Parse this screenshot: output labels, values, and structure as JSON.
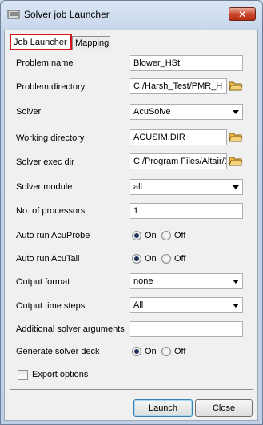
{
  "window": {
    "title": "Solver job Launcher",
    "close_glyph": "✕"
  },
  "tabs": [
    {
      "label": "Job Launcher",
      "active": true
    },
    {
      "label": "Mapping",
      "active": false
    }
  ],
  "fields": {
    "problem_name": {
      "label": "Problem name",
      "value": "Blower_HSt"
    },
    "problem_directory": {
      "label": "Problem directory",
      "value": "C:/Harsh_Test/PMR_H"
    },
    "solver": {
      "label": "Solver",
      "value": "AcuSolve"
    },
    "working_directory": {
      "label": "Working directory",
      "value": "ACUSIM.DIR"
    },
    "solver_exec_dir": {
      "label": "Solver exec dir",
      "value": "C:/Program Files/Altair/1"
    },
    "solver_module": {
      "label": "Solver module",
      "value": "all"
    },
    "num_processors": {
      "label": "No. of processors",
      "value": "1"
    },
    "auto_run_acuprobe": {
      "label": "Auto run AcuProbe",
      "on_label": "On",
      "off_label": "Off",
      "selected": "On"
    },
    "auto_run_acutail": {
      "label": "Auto run AcuTail",
      "on_label": "On",
      "off_label": "Off",
      "selected": "On"
    },
    "output_format": {
      "label": "Output format",
      "value": "none"
    },
    "output_time_steps": {
      "label": "Output time steps",
      "value": "All"
    },
    "additional_args": {
      "label": "Additional solver arguments",
      "value": ""
    },
    "generate_deck": {
      "label": "Generate solver deck",
      "on_label": "On",
      "off_label": "Off",
      "selected": "On"
    },
    "export_options": {
      "label": "Export options",
      "checked": false
    }
  },
  "buttons": {
    "launch": "Launch",
    "close": "Close"
  },
  "colors": {
    "active_tab_border": "#d4141c",
    "close_button": "#c9452a"
  }
}
